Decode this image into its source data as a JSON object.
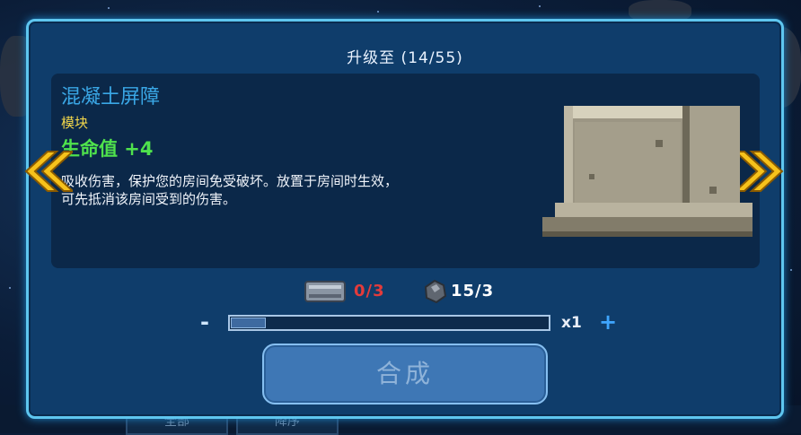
{
  "dialog": {
    "title": "升级至 (14/55)"
  },
  "item": {
    "name": "混凝土屏障",
    "type": "模块",
    "stat": "生命值 +4",
    "description": "吸收伤害，保护您的房间免受破坏。放置于房间时生效，\n可先抵消该房间受到的伤害。",
    "image_icon": "concrete-barrier-icon"
  },
  "resources": {
    "metal_plate": {
      "icon": "metal-plate-icon",
      "text": "0/3",
      "color": "#e33b3b"
    },
    "ore": {
      "icon": "ore-icon",
      "text": "15/3",
      "color": "#ffffff"
    }
  },
  "quantity": {
    "minus_label": "-",
    "plus_label": "+",
    "value_text": "x1",
    "progress": 0.11
  },
  "craft_button": {
    "label": "合成"
  },
  "background_tabs": {
    "all_label": "全部",
    "sort_label": "降序"
  },
  "colors": {
    "accent": "#5ec6ef",
    "name": "#3aa7e6",
    "type": "#f1d64b",
    "stat": "#4fe24c",
    "arrow": "#f6c21b"
  }
}
